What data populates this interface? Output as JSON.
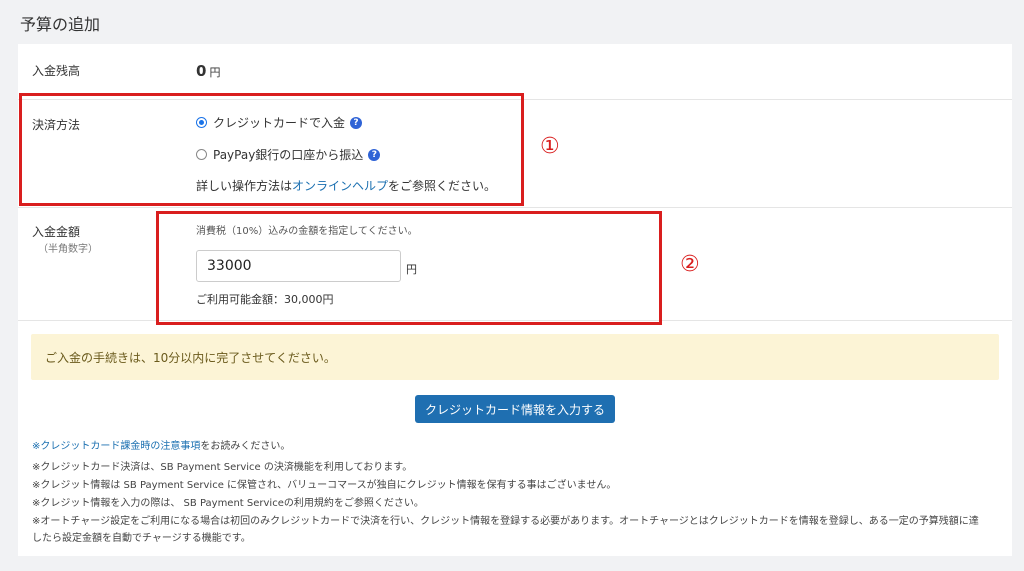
{
  "page": {
    "title": "予算の追加"
  },
  "balance": {
    "label": "入金残高",
    "value": "0",
    "unit": "円"
  },
  "payment_method": {
    "label": "決済方法",
    "options": [
      {
        "label": "クレジットカードで入金",
        "selected": true
      },
      {
        "label": "PayPay銀行の口座から振込",
        "selected": false
      }
    ],
    "help_prefix": "詳しい操作方法は",
    "help_link": "オンラインヘルプ",
    "help_suffix": "をご参照ください。",
    "help_icon": "question-circle-icon"
  },
  "amount": {
    "label": "入金金額",
    "sublabel": "（半角数字）",
    "hint": "消費税（10%）込みの金額を指定してください。",
    "value": "33000",
    "unit": "円",
    "available": "ご利用可能金額：30,000円"
  },
  "annotations": {
    "marker1": "①",
    "marker2": "②"
  },
  "notice": "ご入金の手続きは、10分以内に完了させてください。",
  "submit_label": "クレジットカード情報を入力する",
  "notes": {
    "n1_link": "※クレジットカード課金時の注意事項",
    "n1_suffix": "をお読みください。",
    "n2": "※クレジットカード決済は、SB Payment Service の決済機能を利用しております。",
    "n3": "※クレジット情報は SB Payment Service に保管され、バリューコマースが独自にクレジット情報を保有する事はございません。",
    "n4": "※クレジット情報を入力の際は、 SB Payment Serviceの利用規約をご参照ください。",
    "n5a": "※オートチャージ設定をご利用になる場合は初回のみクレジットカードで決済を行い、クレジット情報を登録する必要があります。オートチャージとはクレジットカードを情報を登録し、ある一定の予算残額に達",
    "n5b": "したら設定金額を自動でチャージする機能です。"
  },
  "colors": {
    "accent": "#1f6fb1",
    "annotation_red": "#d91e1e",
    "notice_bg": "#fcf4d6"
  }
}
